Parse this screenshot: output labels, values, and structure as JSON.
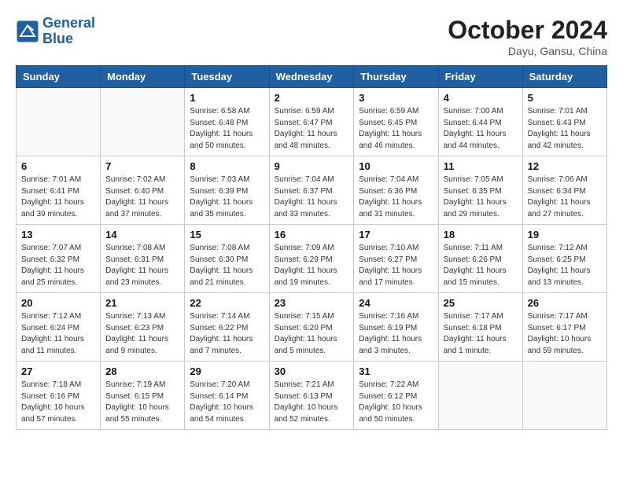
{
  "header": {
    "logo_line1": "General",
    "logo_line2": "Blue",
    "month": "October 2024",
    "location": "Dayu, Gansu, China"
  },
  "weekdays": [
    "Sunday",
    "Monday",
    "Tuesday",
    "Wednesday",
    "Thursday",
    "Friday",
    "Saturday"
  ],
  "weeks": [
    [
      {
        "day": "",
        "info": ""
      },
      {
        "day": "",
        "info": ""
      },
      {
        "day": "1",
        "info": "Sunrise: 6:58 AM\nSunset: 6:48 PM\nDaylight: 11 hours and 50 minutes."
      },
      {
        "day": "2",
        "info": "Sunrise: 6:59 AM\nSunset: 6:47 PM\nDaylight: 11 hours and 48 minutes."
      },
      {
        "day": "3",
        "info": "Sunrise: 6:59 AM\nSunset: 6:45 PM\nDaylight: 11 hours and 46 minutes."
      },
      {
        "day": "4",
        "info": "Sunrise: 7:00 AM\nSunset: 6:44 PM\nDaylight: 11 hours and 44 minutes."
      },
      {
        "day": "5",
        "info": "Sunrise: 7:01 AM\nSunset: 6:43 PM\nDaylight: 11 hours and 42 minutes."
      }
    ],
    [
      {
        "day": "6",
        "info": "Sunrise: 7:01 AM\nSunset: 6:41 PM\nDaylight: 11 hours and 39 minutes."
      },
      {
        "day": "7",
        "info": "Sunrise: 7:02 AM\nSunset: 6:40 PM\nDaylight: 11 hours and 37 minutes."
      },
      {
        "day": "8",
        "info": "Sunrise: 7:03 AM\nSunset: 6:39 PM\nDaylight: 11 hours and 35 minutes."
      },
      {
        "day": "9",
        "info": "Sunrise: 7:04 AM\nSunset: 6:37 PM\nDaylight: 11 hours and 33 minutes."
      },
      {
        "day": "10",
        "info": "Sunrise: 7:04 AM\nSunset: 6:36 PM\nDaylight: 11 hours and 31 minutes."
      },
      {
        "day": "11",
        "info": "Sunrise: 7:05 AM\nSunset: 6:35 PM\nDaylight: 11 hours and 29 minutes."
      },
      {
        "day": "12",
        "info": "Sunrise: 7:06 AM\nSunset: 6:34 PM\nDaylight: 11 hours and 27 minutes."
      }
    ],
    [
      {
        "day": "13",
        "info": "Sunrise: 7:07 AM\nSunset: 6:32 PM\nDaylight: 11 hours and 25 minutes."
      },
      {
        "day": "14",
        "info": "Sunrise: 7:08 AM\nSunset: 6:31 PM\nDaylight: 11 hours and 23 minutes."
      },
      {
        "day": "15",
        "info": "Sunrise: 7:08 AM\nSunset: 6:30 PM\nDaylight: 11 hours and 21 minutes."
      },
      {
        "day": "16",
        "info": "Sunrise: 7:09 AM\nSunset: 6:29 PM\nDaylight: 11 hours and 19 minutes."
      },
      {
        "day": "17",
        "info": "Sunrise: 7:10 AM\nSunset: 6:27 PM\nDaylight: 11 hours and 17 minutes."
      },
      {
        "day": "18",
        "info": "Sunrise: 7:11 AM\nSunset: 6:26 PM\nDaylight: 11 hours and 15 minutes."
      },
      {
        "day": "19",
        "info": "Sunrise: 7:12 AM\nSunset: 6:25 PM\nDaylight: 11 hours and 13 minutes."
      }
    ],
    [
      {
        "day": "20",
        "info": "Sunrise: 7:12 AM\nSunset: 6:24 PM\nDaylight: 11 hours and 11 minutes."
      },
      {
        "day": "21",
        "info": "Sunrise: 7:13 AM\nSunset: 6:23 PM\nDaylight: 11 hours and 9 minutes."
      },
      {
        "day": "22",
        "info": "Sunrise: 7:14 AM\nSunset: 6:22 PM\nDaylight: 11 hours and 7 minutes."
      },
      {
        "day": "23",
        "info": "Sunrise: 7:15 AM\nSunset: 6:20 PM\nDaylight: 11 hours and 5 minutes."
      },
      {
        "day": "24",
        "info": "Sunrise: 7:16 AM\nSunset: 6:19 PM\nDaylight: 11 hours and 3 minutes."
      },
      {
        "day": "25",
        "info": "Sunrise: 7:17 AM\nSunset: 6:18 PM\nDaylight: 11 hours and 1 minute."
      },
      {
        "day": "26",
        "info": "Sunrise: 7:17 AM\nSunset: 6:17 PM\nDaylight: 10 hours and 59 minutes."
      }
    ],
    [
      {
        "day": "27",
        "info": "Sunrise: 7:18 AM\nSunset: 6:16 PM\nDaylight: 10 hours and 57 minutes."
      },
      {
        "day": "28",
        "info": "Sunrise: 7:19 AM\nSunset: 6:15 PM\nDaylight: 10 hours and 55 minutes."
      },
      {
        "day": "29",
        "info": "Sunrise: 7:20 AM\nSunset: 6:14 PM\nDaylight: 10 hours and 54 minutes."
      },
      {
        "day": "30",
        "info": "Sunrise: 7:21 AM\nSunset: 6:13 PM\nDaylight: 10 hours and 52 minutes."
      },
      {
        "day": "31",
        "info": "Sunrise: 7:22 AM\nSunset: 6:12 PM\nDaylight: 10 hours and 50 minutes."
      },
      {
        "day": "",
        "info": ""
      },
      {
        "day": "",
        "info": ""
      }
    ]
  ]
}
